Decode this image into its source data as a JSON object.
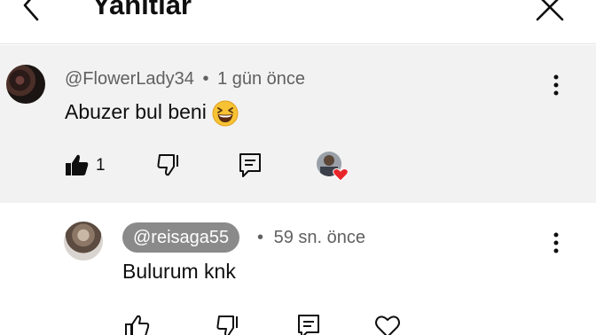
{
  "header": {
    "title": "Yanıtlar",
    "back_icon": "chevron-left-icon",
    "close_icon": "close-icon"
  },
  "parent_comment": {
    "handle": "@FlowerLady34",
    "separator": "•",
    "time": "1 gün önce",
    "text": "Abuzer bul beni",
    "emoji": "grinning-squinting-face",
    "like_count": "1",
    "background": "#f2f2f2",
    "creator_heart": "red-heart-icon"
  },
  "reply_comment": {
    "handle": "@reisaga55",
    "separator": "•",
    "time": "59 sn. önce",
    "text": "Bulurum knk",
    "handle_chip_color": "#8a8a8a"
  },
  "colors": {
    "meta_text": "#606060",
    "heart": "#e8262a"
  }
}
